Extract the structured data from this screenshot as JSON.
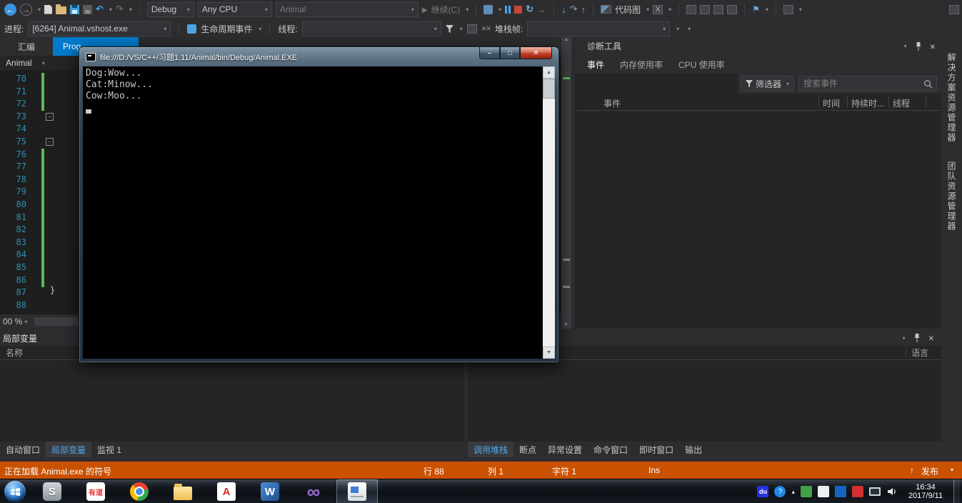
{
  "toolbar": {
    "debug_config": "Debug",
    "platform": "Any CPU",
    "startup_project": "Animal",
    "continue_label": "继续(C)",
    "codemap_label": "代码图"
  },
  "debug_location_bar": {
    "process_label": "进程:",
    "process_value": "[6264] Animal.vshost.exe",
    "lifecycle_events_label": "生命周期事件",
    "thread_label": "线程:",
    "stack_frame_label": "堆栈帧:"
  },
  "editor": {
    "tab_disassembly": "汇编",
    "tab_program": "Prog",
    "nav_project": "Animal",
    "line_numbers": [
      "70",
      "71",
      "72",
      "73",
      "74",
      "75",
      "76",
      "77",
      "78",
      "79",
      "80",
      "81",
      "82",
      "83",
      "84",
      "85",
      "86",
      "87",
      "88"
    ],
    "closing_brace": "}",
    "zoom_level": "00 %"
  },
  "console_window": {
    "title": "file:///D:/VS/C++/习题1.11/Animal/bin/Debug/Animal.EXE",
    "output_lines": [
      "Dog:Wow...",
      "Cat:Minow...",
      "Cow:Moo..."
    ]
  },
  "diagnostics": {
    "title": "诊断工具",
    "tab_events": "事件",
    "tab_memory": "内存使用率",
    "tab_cpu": "CPU 使用率",
    "filter_label": "筛选器",
    "search_placeholder": "搜索事件",
    "col_event": "事件",
    "col_time": "时间",
    "col_duration": "持续时...",
    "col_thread": "线程"
  },
  "right_edge_tabs": {
    "solution_explorer": "解决方案资源管理器",
    "team_explorer": "团队资源管理器"
  },
  "locals_panel": {
    "title": "局部变量",
    "col_name": "名称",
    "tab_autos": "自动窗口",
    "tab_locals": "局部变量",
    "tab_watch": "监视 1"
  },
  "callstack_panel": {
    "col_language": "语言",
    "tab_callstack": "调用堆栈",
    "tab_breakpoints": "断点",
    "tab_exceptions": "异常设置",
    "tab_command": "命令窗口",
    "tab_immediate": "即时窗口",
    "tab_output": "输出"
  },
  "status_bar": {
    "message": "正在加载 Animal.exe 的符号",
    "line": "行 88",
    "column": "列 1",
    "character": "字符 1",
    "insert_mode": "Ins",
    "publish_label": "发布",
    "publish_arrow": "↑"
  },
  "taskbar": {
    "s_label": "S",
    "youdao_label": "有道",
    "adobe_label": "A",
    "word_label": "W",
    "vs_label": "∞",
    "baidu_label": "du",
    "help_label": "?",
    "time": "16:34",
    "date": "2017/9/11"
  },
  "colors": {
    "accent_blue": "#007ACC",
    "status_orange": "#CA5100",
    "line_number_blue": "#2B91AF",
    "change_bar_green": "#57B957",
    "stop_red": "#C74634"
  }
}
